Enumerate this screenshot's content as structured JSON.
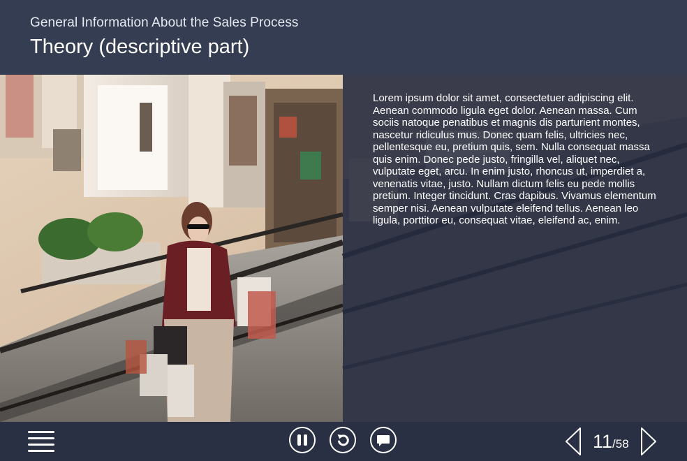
{
  "header": {
    "subtitle": "General Information About the Sales Process",
    "title": "Theory (descriptive part)"
  },
  "main": {
    "background_image": "shopping-mall-escalator-woman-with-bags",
    "body_text": "Lorem ipsum dolor sit amet, consectetuer adipiscing elit. Aenean commodo ligula eget dolor. Aenean massa. Cum sociis natoque penatibus et magnis dis parturient montes, nascetur ridiculus mus. Donec quam felis, ultricies nec, pellentesque eu, pretium quis, sem. Nulla consequat massa quis enim. Donec pede justo, fringilla vel, aliquet nec, vulputate eget, arcu. In enim justo, rhoncus ut, imperdiet a, venenatis vitae, justo. Nullam dictum felis eu pede mollis pretium. Integer tincidunt. Cras dapibus. Vivamus elementum semper nisi. Aenean vulputate eleifend tellus. Aenean leo ligula, porttitor eu, consequat vitae, eleifend ac, enim."
  },
  "footer": {
    "icons": {
      "menu": "hamburger-menu-icon",
      "pause": "pause-icon",
      "replay": "replay-icon",
      "comment": "comment-icon",
      "prev": "chevron-left-icon",
      "next": "chevron-right-icon"
    },
    "pagination": {
      "current": "11",
      "separator": "/",
      "total": "58"
    }
  },
  "colors": {
    "header_bg": "#353d52",
    "footer_bg": "#293043",
    "overlay": "#283046",
    "text": "#ffffff"
  }
}
